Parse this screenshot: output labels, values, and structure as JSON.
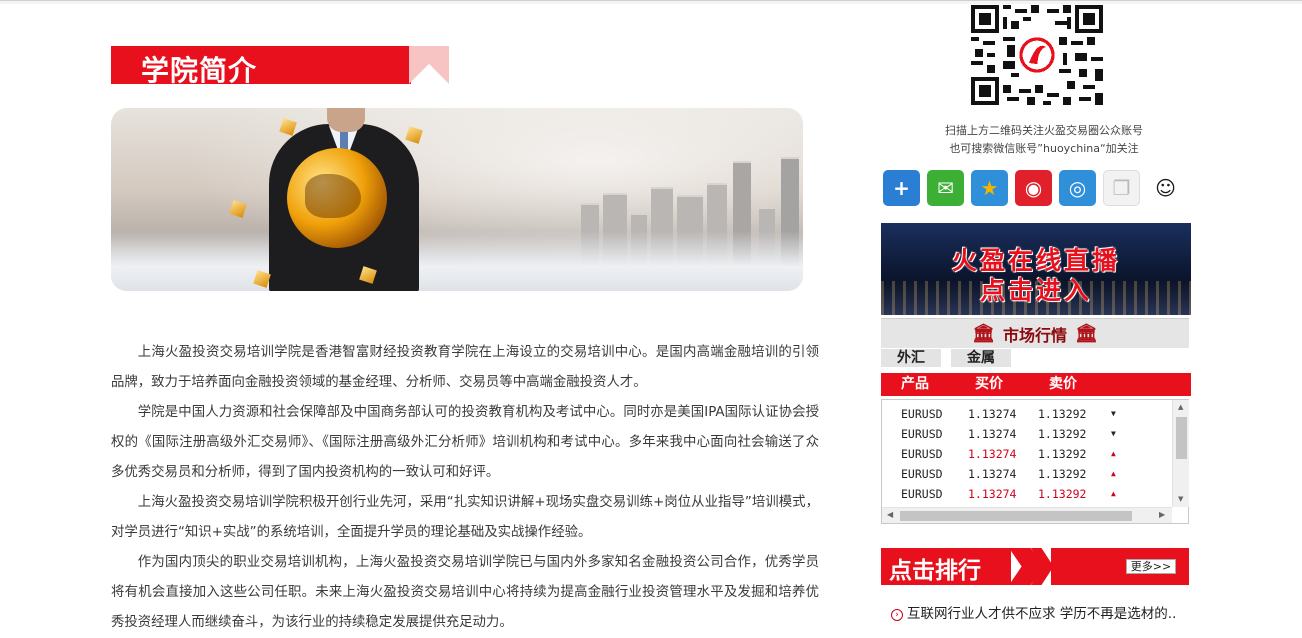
{
  "section": {
    "title": "学院简介"
  },
  "intro": {
    "paragraphs": [
      "上海火盈投资交易培训学院是香港智富财经投资教育学院在上海设立的交易培训中心。是国内高端金融培训的引领品牌，致力于培养面向金融投资领域的基金经理、分析师、交易员等中高端金融投资人才。",
      "学院是中国人力资源和社会保障部及中国商务部认可的投资教育机构及考试中心。同时亦是美国IPA国际认证协会授权的《国际注册高级外汇交易师》、《国际注册高级外汇分析师》培训机构和考试中心。多年来我中心面向社会输送了众多优秀交易员和分析师，得到了国内投资机构的一致认可和好评。",
      "上海火盈投资交易培训学院积极开创行业先河，采用“扎实知识讲解+现场实盘交易训练+岗位从业指导”培训模式，对学员进行“知识+实战”的系统培训，全面提升学员的理论基础及实战操作经验。",
      "作为国内顶尖的职业交易培训机构，上海火盈投资交易培训学院已与国内外多家知名金融投资公司合作，优秀学员将有机会直接加入这些公司任职。未来上海火盈投资交易培训中心将持续为提高金融行业投资管理水平及发掘和培养优秀投资经理人而继续奋斗，为该行业的持续稳定发展提供充足动力。"
    ]
  },
  "qr": {
    "caption1": "扫描上方二维码关注火盈交易圈公众账号",
    "caption2": "也可搜索微信账号”huoychina“加关注"
  },
  "share": {
    "icons": [
      {
        "name": "plus-share-icon",
        "glyph": "+",
        "color": "#2a7fd4"
      },
      {
        "name": "wechat-icon",
        "glyph": "✉",
        "color": "#3cb034"
      },
      {
        "name": "qzone-icon",
        "glyph": "★",
        "color": "#f5b400"
      },
      {
        "name": "weibo-icon",
        "glyph": "◉",
        "color": "#e0202a"
      },
      {
        "name": "tencent-weibo-icon",
        "glyph": "◎",
        "color": "#2f8fd8"
      },
      {
        "name": "copy-icon",
        "glyph": "❐",
        "color": "#b9b9b9"
      },
      {
        "name": "qq-icon",
        "glyph": "☺",
        "color": "#1a1a1a"
      }
    ]
  },
  "live": {
    "line1": "火盈在线直播",
    "line2": "点击进入"
  },
  "market": {
    "title": "市场行情",
    "tabs": [
      "外汇",
      "金属"
    ],
    "columns": [
      "产品",
      "买价",
      "卖价"
    ],
    "rows": [
      {
        "symbol": "EURUSD",
        "bid": "1.13274",
        "ask": "1.13292",
        "dir": "down",
        "bid_red": false,
        "ask_red": false
      },
      {
        "symbol": "EURUSD",
        "bid": "1.13274",
        "ask": "1.13292",
        "dir": "down",
        "bid_red": false,
        "ask_red": false
      },
      {
        "symbol": "EURUSD",
        "bid": "1.13274",
        "ask": "1.13292",
        "dir": "up",
        "bid_red": true,
        "ask_red": false
      },
      {
        "symbol": "EURUSD",
        "bid": "1.13274",
        "ask": "1.13292",
        "dir": "up",
        "bid_red": false,
        "ask_red": false
      },
      {
        "symbol": "EURUSD",
        "bid": "1.13274",
        "ask": "1.13292",
        "dir": "up",
        "bid_red": true,
        "ask_red": true
      }
    ]
  },
  "ranking": {
    "title": "点击排行",
    "more": "更多>>",
    "items": [
      "互联网行业人才供不应求 学历不再是选材的.."
    ]
  }
}
